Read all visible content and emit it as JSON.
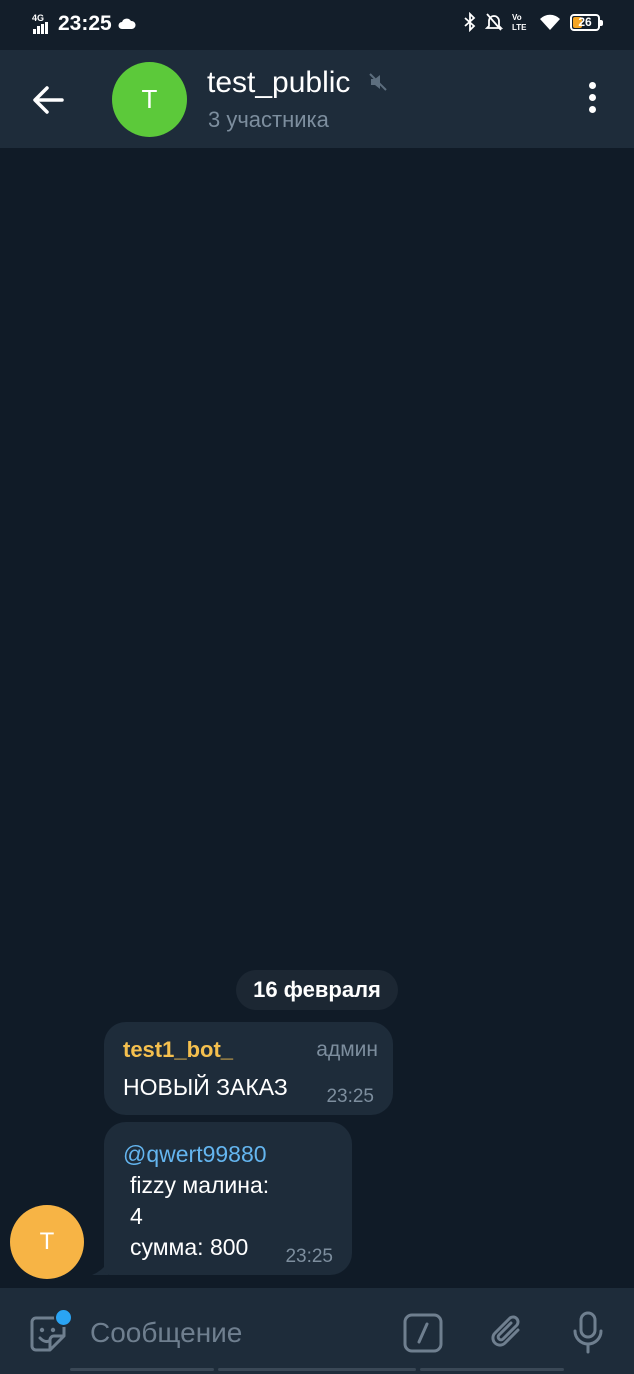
{
  "status_bar": {
    "network": "4G",
    "time": "23:25",
    "volte": "Vo LTE",
    "battery": "26",
    "battery_level_percent": 26
  },
  "header": {
    "avatar_letter": "T",
    "avatar_color": "#5cc93a",
    "title": "test_public",
    "subtitle": "3 участника",
    "icons": [
      "back-arrow-icon",
      "muted-speaker-icon",
      "more-vertical-icon"
    ]
  },
  "chat": {
    "date_separator": "16 февраля",
    "messages": [
      {
        "sender": "test1_bot_",
        "sender_color": "#f5c04e",
        "role": "админ",
        "text": "НОВЫЙ ЗАКАЗ",
        "time": "23:25"
      },
      {
        "mention": "@qwert99880",
        "mention_color": "#64b5ef",
        "lines": [
          "fizzy малина:",
          "4",
          "сумма: 800"
        ],
        "time": "23:25",
        "avatar_letter": "T",
        "avatar_color": "#f7b445"
      }
    ]
  },
  "composer": {
    "placeholder": "Сообщение",
    "icons": [
      "sticker-icon",
      "bot-command-icon",
      "paperclip-icon",
      "microphone-icon"
    ],
    "notification_dot_color": "#2aa4f4"
  },
  "colors": {
    "background": "#101b27",
    "header": "#1e2c3a",
    "bubble": "#1e2c3a"
  }
}
